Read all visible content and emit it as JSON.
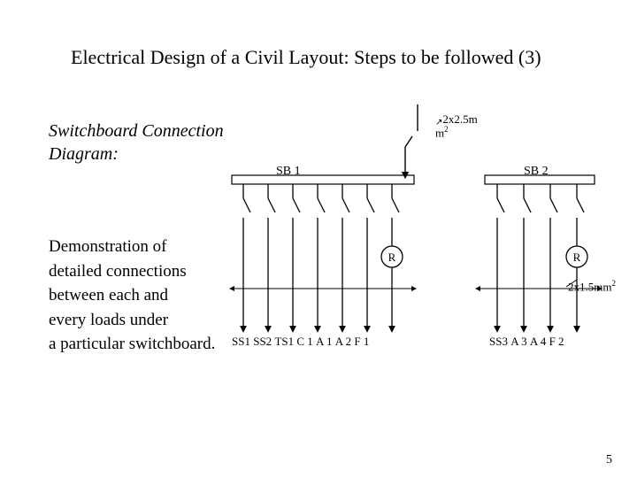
{
  "title": "Electrical Design of a Civil Layout: Steps to be followed (3)",
  "subtitle_line1": "Switchboard Connection",
  "subtitle_line2": "Diagram:",
  "desc_l1": "Demonstration of",
  "desc_l2": "detailed connections",
  "desc_l3": "between each and",
  "desc_l4": "every loads under",
  "desc_l5": "a particular switchboard.",
  "page_number": "5",
  "sb1": {
    "label": "SB 1",
    "feeders": [
      "SS1",
      "SS2",
      "TS1",
      "C 1",
      "A 1",
      "A 2",
      "F 1"
    ]
  },
  "sb2": {
    "label": "SB 2",
    "feeders": [
      "SS3",
      "A 3",
      "A 4",
      "F 2"
    ]
  },
  "incomer_note_top": "2x2.5m",
  "incomer_note_bot": "m",
  "incomer_note_sup": "2",
  "cable_note": "2x1.5mm",
  "cable_note_sup": "2",
  "regulator": "R"
}
